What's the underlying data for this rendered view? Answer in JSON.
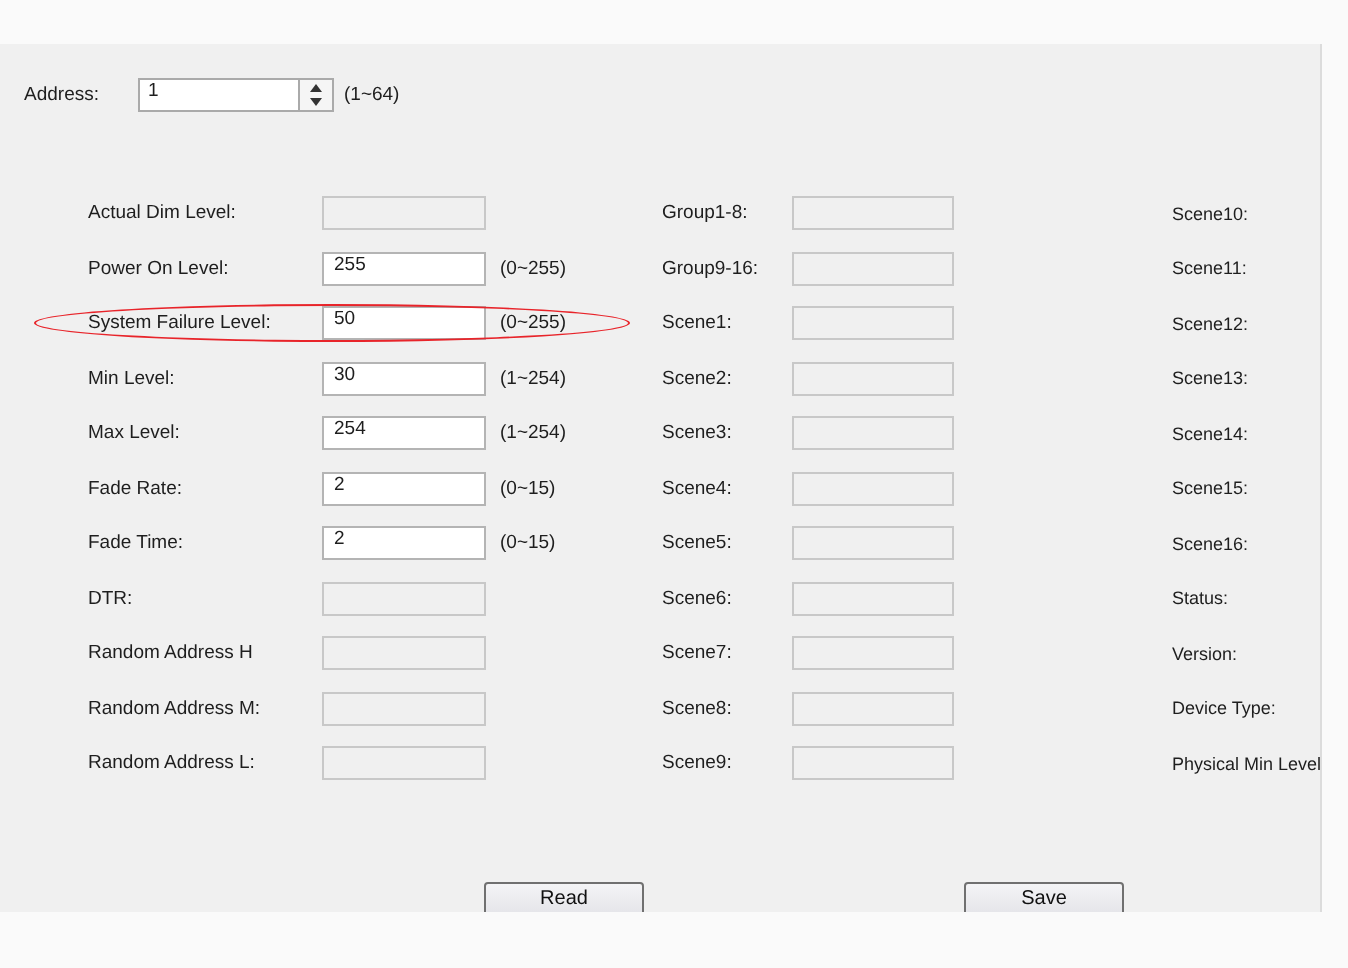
{
  "address": {
    "label": "Address:",
    "value": "1",
    "range": "(1~64)"
  },
  "left_rows": [
    {
      "label": "Actual Dim Level:",
      "disabled": true,
      "circled": false
    },
    {
      "label": "Power On Level:",
      "value": "255",
      "range": "(0~255)",
      "disabled": false,
      "circled": false
    },
    {
      "label": "System Failure Level:",
      "value": "50",
      "range": "(0~255)",
      "disabled": false,
      "circled": true
    },
    {
      "label": "Min Level:",
      "value": "30",
      "range": "(1~254)",
      "disabled": false,
      "circled": false
    },
    {
      "label": "Max Level:",
      "value": "254",
      "range": "(1~254)",
      "disabled": false,
      "circled": false
    },
    {
      "label": "Fade Rate:",
      "value": "2",
      "range": "(0~15)",
      "disabled": false,
      "circled": false
    },
    {
      "label": "Fade Time:",
      "value": "2",
      "range": "(0~15)",
      "disabled": false,
      "circled": false
    },
    {
      "label": "DTR:",
      "disabled": true,
      "circled": false
    },
    {
      "label": "Random Address H",
      "disabled": true,
      "circled": false
    },
    {
      "label": "Random Address M:",
      "disabled": true,
      "circled": false
    },
    {
      "label": "Random Address L:",
      "disabled": true,
      "circled": false
    }
  ],
  "middle_rows": [
    {
      "label": "Group1-8:",
      "disabled": true
    },
    {
      "label": "Group9-16:",
      "disabled": true
    },
    {
      "label": "Scene1:",
      "disabled": true
    },
    {
      "label": "Scene2:",
      "disabled": true
    },
    {
      "label": "Scene3:",
      "disabled": true
    },
    {
      "label": "Scene4:",
      "disabled": true
    },
    {
      "label": "Scene5:",
      "disabled": true
    },
    {
      "label": "Scene6:",
      "disabled": true
    },
    {
      "label": "Scene7:",
      "disabled": true
    },
    {
      "label": "Scene8:",
      "disabled": true
    },
    {
      "label": "Scene9:",
      "disabled": true
    }
  ],
  "right_labels": [
    "Scene10:",
    "Scene11:",
    "Scene12:",
    "Scene13:",
    "Scene14:",
    "Scene15:",
    "Scene16:",
    "Status:",
    "Version:",
    "Device Type:",
    "Physical Min Level"
  ],
  "buttons": [
    "Read",
    "Save"
  ]
}
